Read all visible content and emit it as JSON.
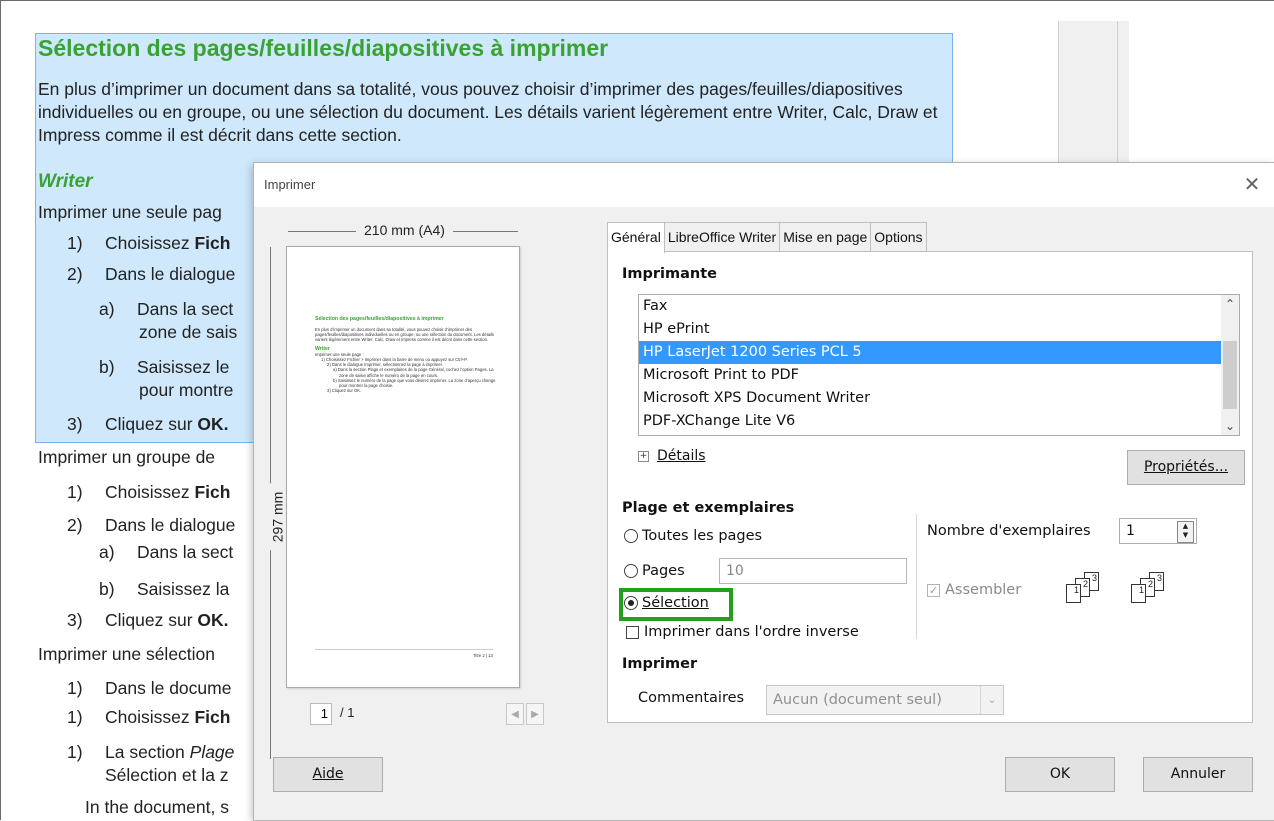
{
  "document": {
    "heading": "Sélection des pages/feuilles/diapositives à imprimer",
    "paragraph": "En plus d’imprimer un document dans sa totalité, vous pouvez choisir d’imprimer des pages/feuilles/diapositives individuelles ou en groupe, ou une sélection du document. Les détails varient légèrement entre Writer, Calc, Draw et Impress comme il est décrit dans cette section.",
    "writer_heading": "Writer",
    "lines": [
      {
        "num": "",
        "text": "Imprimer une seule pag"
      },
      {
        "num": "1)",
        "text": "Choisissez ",
        "bold": "Fich"
      },
      {
        "num": "2)",
        "text": "Dans le dialogue"
      },
      {
        "num": "a)",
        "text": "Dans la sect"
      },
      {
        "num": "",
        "text": "zone de sais"
      },
      {
        "num": "b)",
        "text": "Saisissez le"
      },
      {
        "num": "",
        "text": "pour montre"
      },
      {
        "num": "3)",
        "text": "Cliquez sur ",
        "bold": "OK."
      },
      {
        "num": "",
        "text": "Imprimer un groupe de"
      },
      {
        "num": "1)",
        "text": "Choisissez ",
        "bold": "Fich"
      },
      {
        "num": "2)",
        "text": "Dans le dialogue"
      },
      {
        "num": "a)",
        "text": "Dans la sect"
      },
      {
        "num": "b)",
        "text": "Saisissez la"
      },
      {
        "num": "3)",
        "text": "Cliquez sur ",
        "bold": "OK."
      },
      {
        "num": "",
        "text": "Imprimer une sélection"
      },
      {
        "num": "1)",
        "text": "Dans le docume"
      },
      {
        "num": "1)",
        "text": "Choisissez ",
        "bold": "Fich"
      },
      {
        "num": "1)",
        "text": "La section ",
        "italic": "Plage"
      },
      {
        "num": "",
        "text": "Sélection et la z"
      },
      {
        "num": "",
        "text": "In the document, s"
      }
    ]
  },
  "dialog": {
    "title": "Imprimer",
    "close_glyph": "✕",
    "preview": {
      "width_label": "210 mm (A4)",
      "height_label": "297 mm",
      "page_current": "1",
      "page_total": "/ 1",
      "prev_glyph": "◀",
      "next_glyph": "▶",
      "thumb_title": "Sélection des pages/feuilles/diapositives à imprimer",
      "thumb_lines": [
        "En plus d’imprimer un document dans sa totalité, vous pouvez choisir d’imprimer des",
        "pages/feuilles/diapositives individuelles ou en groupe, ou une sélection du document. Les détails",
        "varient légèrement entre Writer, Calc, Draw et Impress comme il est décrit dans cette section."
      ],
      "thumb_writer": "Writer",
      "thumb_list": [
        "Imprimer une seule page :",
        "1)   Choisissez Fichier > Imprimer dans la barre de menu ou appuyez sur Ctrl+P.",
        "2)   Dans le dialogue Imprimer, sélectionnez la page à imprimer.",
        "a)  Dans la section Plage et exemplaires de la page Général, cochez l’option Pages. La",
        "zone de saisie affiche le numéro de la page en cours.",
        "b)  Saisissez le numéro de la page que vous désirez imprimer. La zone d’aperçu change",
        "pour montrer la page choisie.",
        "3)   Cliquez sur OK."
      ],
      "thumb_footer": "Titre 2 | 13"
    },
    "tabs": [
      "Général",
      "LibreOffice Writer",
      "Mise en page",
      "Options"
    ],
    "active_tab": "Général",
    "printer_section": "Imprimante",
    "printers": [
      "Fax",
      "HP ePrint",
      "HP LaserJet 1200 Series PCL 5",
      "Microsoft Print to PDF",
      "Microsoft XPS Document Writer",
      "PDF-XChange Lite V6"
    ],
    "selected_printer": "HP LaserJet 1200 Series PCL 5",
    "details_label": "Détails",
    "properties_button": "Propriétés...",
    "range_section": "Plage et exemplaires",
    "radio_all": "Toutes les pages",
    "radio_pages": "Pages",
    "pages_value": "10",
    "radio_selection": "Sélection",
    "selected_range": "Sélection",
    "reverse_label": "Imprimer dans l'ordre inverse",
    "reverse_checked": false,
    "copies_label": "Nombre d'exemplaires",
    "copies_value": "1",
    "collate_label": "Assembler",
    "collate_checked": true,
    "print_section": "Imprimer",
    "comments_label": "Commentaires",
    "comments_value": "Aucun (document seul)",
    "help_button": "Aide",
    "ok_button": "OK",
    "cancel_button": "Annuler",
    "highlight_color": "#22a01c",
    "selection_color": "#3399ff"
  }
}
